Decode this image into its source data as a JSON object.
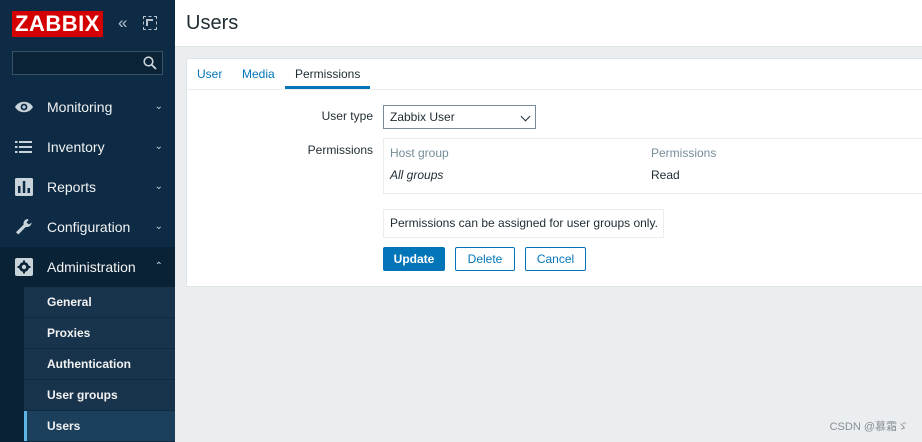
{
  "sidebar": {
    "logo": "ZABBIX",
    "collapse_symbol": "«",
    "search": {
      "value": "",
      "placeholder": ""
    },
    "menu": [
      {
        "label": "Monitoring",
        "icon": "eye-icon",
        "chevron": "⌄"
      },
      {
        "label": "Inventory",
        "icon": "list-icon",
        "chevron": "⌄"
      },
      {
        "label": "Reports",
        "icon": "bar-chart-icon",
        "chevron": "⌄"
      },
      {
        "label": "Configuration",
        "icon": "wrench-icon",
        "chevron": "⌄"
      },
      {
        "label": "Administration",
        "icon": "gear-icon",
        "chevron": "⌃"
      }
    ],
    "submenu": [
      "General",
      "Proxies",
      "Authentication",
      "User groups",
      "Users"
    ],
    "selected_submenu": "Users"
  },
  "header": {
    "title": "Users"
  },
  "tabs": [
    {
      "label": "User"
    },
    {
      "label": "Media"
    },
    {
      "label": "Permissions"
    }
  ],
  "active_tab": "Permissions",
  "form": {
    "user_type_label": "User type",
    "user_type_value": "Zabbix User",
    "permissions_label": "Permissions",
    "table": {
      "headers": [
        "Host group",
        "Permissions"
      ],
      "rows": [
        [
          "All groups",
          "Read"
        ]
      ]
    },
    "info": "Permissions can be assigned for user groups only.",
    "buttons": {
      "update": "Update",
      "delete": "Delete",
      "cancel": "Cancel"
    }
  },
  "watermark": "CSDN @慕霜ゞ",
  "colors": {
    "sidebar_bg": "#0d2b45",
    "accent": "#0275b8",
    "logo_bg": "#d40000"
  }
}
